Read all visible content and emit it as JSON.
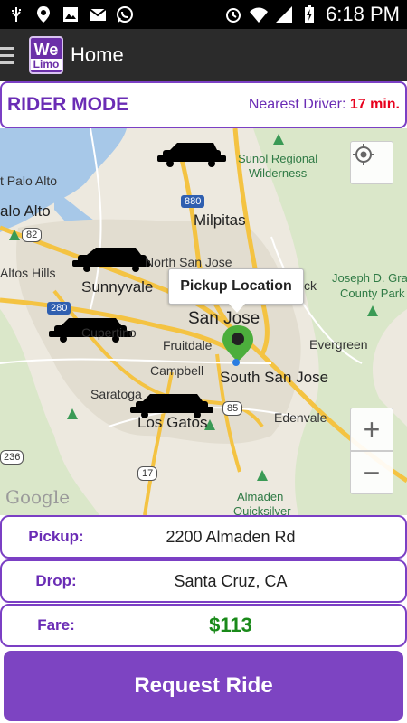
{
  "status_bar": {
    "time": "6:18 PM",
    "icons": [
      "usb-icon",
      "location-icon",
      "image-icon",
      "gmail-icon",
      "whatsapp-icon",
      "alarm-icon",
      "wifi-icon",
      "signal-icon",
      "battery-charging-icon"
    ]
  },
  "action_bar": {
    "logo_top": "We",
    "logo_bottom": "Limo",
    "title": "Home"
  },
  "rider_bar": {
    "mode_label": "RIDER MODE",
    "nearest_label": "Nearest Driver:",
    "nearest_value": "17 min."
  },
  "map": {
    "callout": "Pickup Location",
    "labels": {
      "sunol": "Sunol Regional",
      "wilderness": "Wilderness",
      "palo_alto_east": "t Palo Alto",
      "palo_alto": "alo Alto",
      "milpitas": "Milpitas",
      "north_san_jose": "North San Jose",
      "altos_hills": "Altos Hills",
      "sunnyvale": "Sunnyvale",
      "cupertino": "Cupertino",
      "san_jose": "San Jose",
      "fruitdale": "Fruitdale",
      "campbell": "Campbell",
      "south_san_jose": "South San Jose",
      "evergreen": "Evergreen",
      "saratoga": "Saratoga",
      "los_gatos": "Los Gatos",
      "edenvale": "Edenvale",
      "joseph_grant_1": "Joseph D. Gra",
      "joseph_grant_2": "County Park",
      "almaden_1": "Almaden",
      "almaden_2": "Quicksilver",
      "ck": "ck"
    },
    "shields": {
      "i880": "880",
      "r82": "82",
      "i280": "280",
      "r85": "85",
      "r17": "17",
      "r236": "236"
    },
    "attribution": "Google",
    "zoom_in": "+",
    "zoom_out": "−"
  },
  "ride_info": {
    "pickup_label": "Pickup:",
    "pickup_value": "2200 Almaden Rd",
    "drop_label": "Drop:",
    "drop_value": "Santa Cruz, CA",
    "fare_label": "Fare:",
    "fare_value": "$113"
  },
  "request_button": "Request Ride",
  "colors": {
    "accent": "#7d44c2",
    "price": "#1a8a1a",
    "eta": "#e8001c"
  }
}
